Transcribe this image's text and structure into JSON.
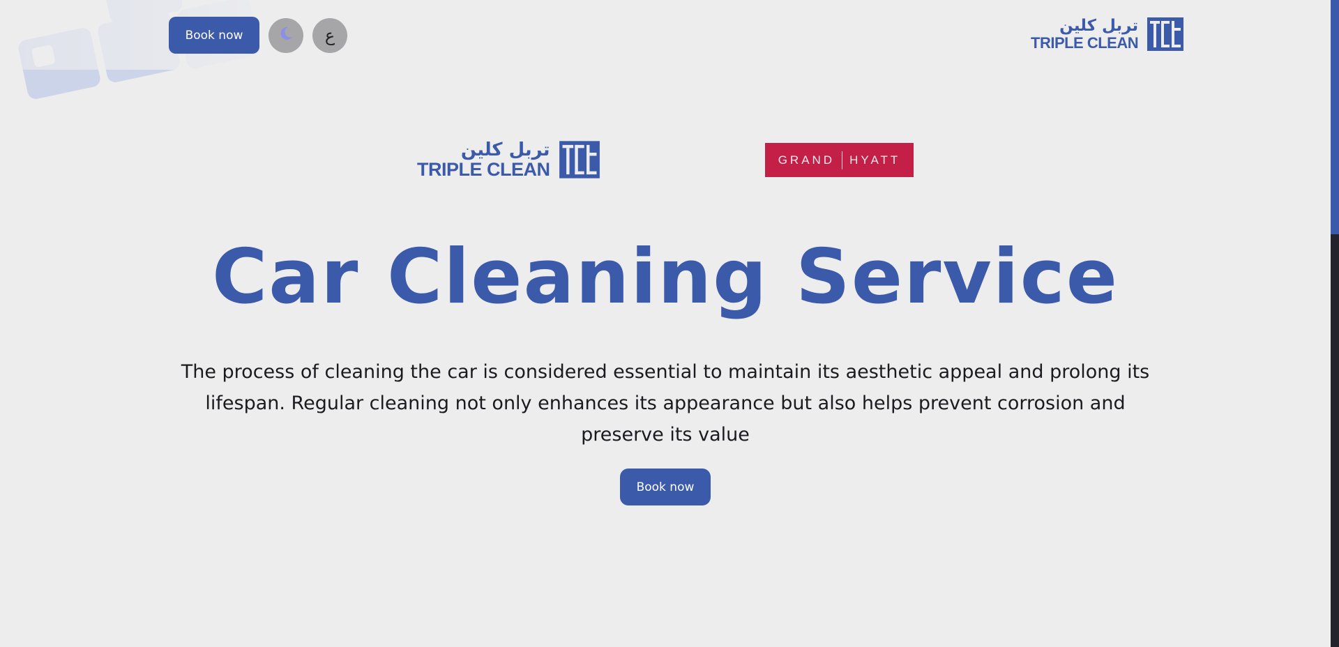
{
  "header": {
    "book_button_label": "Book now",
    "theme_toggle_icon": "moon-icon",
    "language_toggle_label": "ع"
  },
  "brand": {
    "arabic_name": "تربل كلين",
    "english_name": "TRIPLE CLEAN",
    "mark_letters": "TCL",
    "color": "#3c5aaa"
  },
  "partners": [
    {
      "arabic_name": "تربل كلين",
      "english_name": "TRIPLE CLEAN",
      "mark_letters": "TCL"
    },
    {
      "left_word": "GRAND",
      "right_word": "HYATT",
      "color": "#c41f47"
    }
  ],
  "hero": {
    "title": "Car Cleaning Service",
    "description": "The process of cleaning the car is considered essential to maintain its aesthetic appeal and prolong its lifespan. Regular cleaning not only enhances its appearance but also helps prevent corrosion and preserve its value",
    "button_label": "Book now"
  },
  "colors": {
    "accent": "#3c5aaa",
    "background": "#ededee",
    "scrollbar_track": "#24232b"
  }
}
